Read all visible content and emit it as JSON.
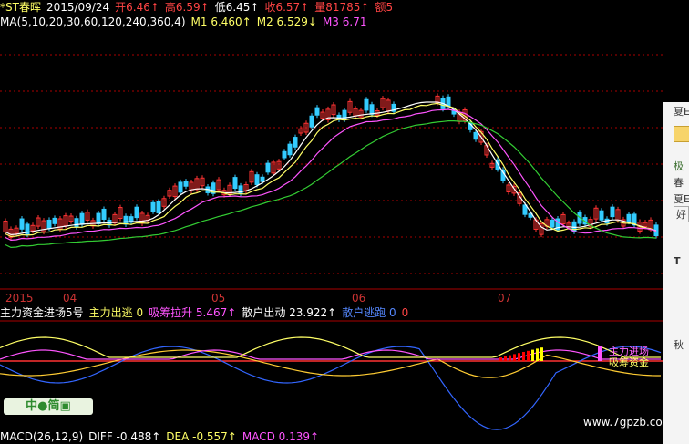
{
  "header": {
    "stock_name": "*ST春晖",
    "date": "2015/09/24",
    "open": "开6.46↑",
    "high": "高6.59↑",
    "low": "低6.45↑",
    "close": "收6.57↑",
    "volume": "量81785↑",
    "amount": "额5"
  },
  "ma_row": {
    "label": "MA(5,10,20,30,60,120,240,360,4)",
    "m1": "M1 6.460↑",
    "m2": "M2 6.529↓",
    "m3": "M3 6.71"
  },
  "x_axis": {
    "labels": [
      "2015",
      "04",
      "05",
      "06",
      "07"
    ]
  },
  "indicator_row": {
    "title": "主力资金进场5号",
    "main_out": "主力出逃 0",
    "accumulate": "吸筹拉升 5.467↑",
    "retail_out": "散户出动 23.922↑",
    "retail_flee": "散户逃跑 0",
    "tail": "0"
  },
  "chart_annotations": {
    "main_enter": "主力进场",
    "accumulate_capital": "吸筹资金"
  },
  "logo": {
    "text": "中●简▣"
  },
  "watermark": "www.7gpzb.com",
  "macd_row": {
    "label": "MACD(26,12,9)",
    "diff": "DIFF -0.488↑",
    "dea": "DEA -0.557↑",
    "macd": "MACD 0.139↑"
  },
  "side_panel": {
    "items": [
      "夏E",
      "极",
      "春",
      "夏E",
      "好",
      "T",
      "秋"
    ]
  },
  "colors": {
    "up": "#ff3333",
    "down": "#33ccff",
    "ma5": "#ffffff",
    "ma10": "#ffff66",
    "ma20": "#ff55ff",
    "ma30": "#33cc33",
    "axis": "#aa0000",
    "macd_up": "#ff0000",
    "macd_down": "#ffff00",
    "diff": "#ffcc33",
    "dea": "#3366ff"
  }
}
